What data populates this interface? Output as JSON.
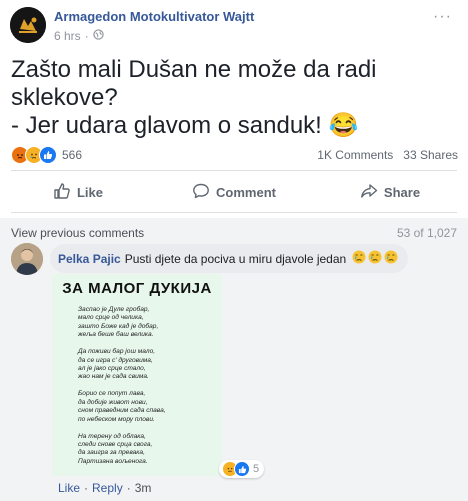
{
  "post": {
    "page_name": "Armagedon Motokultivator Wajtt",
    "time": "6 hrs",
    "separator": "·",
    "more": "···",
    "text_lines": [
      "Zašto mali Dušan ne može da radi",
      "sklekove?",
      "- Jer udara glavom o sanduk! 😂"
    ],
    "reaction_count": "566",
    "comments_count": "1K Comments",
    "shares_count": "33 Shares"
  },
  "actions": {
    "like": "Like",
    "comment": "Comment",
    "share": "Share"
  },
  "comments_section": {
    "view_previous": "View previous comments",
    "paging": "53 of 1,027",
    "comment": {
      "author": "Pelka Pajic",
      "text": "Pusti djete da pociva u miru djavole jedan",
      "emoji": "😢",
      "image": {
        "title": "ЗА МАЛОГ ДУКИЈА",
        "stanzas": [
          [
            "Заспао је Дуле гробар,",
            "мало срце од челика,",
            "зашто Боже кад је добар,",
            "жеља беше баш велика."
          ],
          [
            "Да поживи бар још мало,",
            "да се игра с' друговима,",
            "ал је јако срце стало,",
            "жао нам је сада свима."
          ],
          [
            "Борио се попут лава,",
            "да добије живот нови,",
            "сном праведним сада спава,",
            "по небеском мору плови."
          ],
          [
            "На терену од облака,",
            "следи снове срца свога,",
            "да заигра за превака,",
            "Партизана вољенога."
          ]
        ]
      },
      "image_reaction_count": "5",
      "like": "Like",
      "reply": "Reply",
      "separator": "·",
      "time": "3m"
    }
  },
  "colors": {
    "link": "#385898",
    "like_blue": "#1877f2",
    "sad_yellow": "#f7b125",
    "angry_red": "#e9710f"
  }
}
